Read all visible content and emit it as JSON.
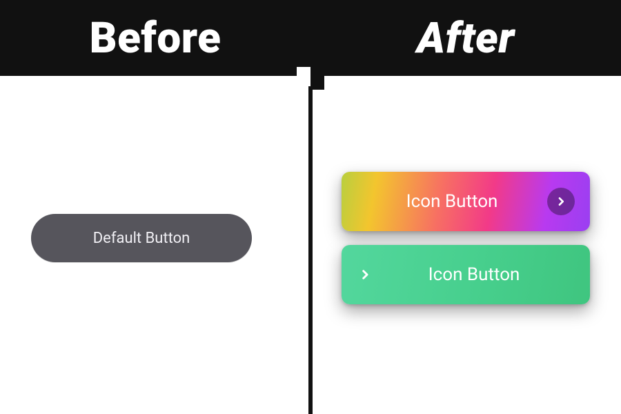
{
  "header": {
    "before_title": "Before",
    "after_title": "After"
  },
  "before": {
    "default_button_label": "Default Button"
  },
  "after": {
    "button_a_label": "Icon Button",
    "button_b_label": "Icon Button"
  }
}
